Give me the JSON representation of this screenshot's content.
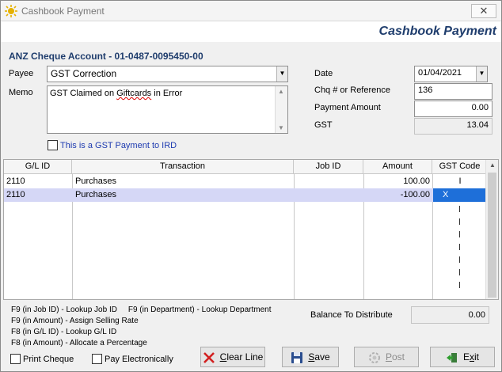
{
  "window": {
    "title": "Cashbook Payment",
    "banner_title": "Cashbook Payment",
    "close_glyph": "✕"
  },
  "form": {
    "account": "ANZ Cheque Account - 01-0487-0095450-00",
    "payee_label": "Payee",
    "payee_value": "GST Correction",
    "memo_label": "Memo",
    "memo_prefix": "GST Claimed on ",
    "memo_misspelled": "Giftcards",
    "memo_suffix": " in Error",
    "gst_ird_label": "This is a GST Payment to IRD",
    "date_label": "Date",
    "date_value": "01/04/2021",
    "chq_label": "Chq # or Reference",
    "chq_value": "136",
    "payment_label": "Payment Amount",
    "payment_value": "0.00",
    "gst_label": "GST",
    "gst_value": "13.04"
  },
  "grid": {
    "headers": [
      "G/L ID",
      "Transaction",
      "Job ID",
      "Amount",
      "GST Code"
    ],
    "rows": [
      {
        "gl_id": "2110",
        "transaction": "Purchases",
        "job_id": "",
        "amount": "100.00",
        "gst_code": "I"
      },
      {
        "gl_id": "2110",
        "transaction": "Purchases",
        "job_id": "",
        "amount": "-100.00",
        "gst_code": "X"
      }
    ]
  },
  "hints": [
    "F9 (in Job ID) - Lookup Job ID     F9 (in Department) - Lookup Department",
    "F9 (in Amount) - Assign Selling Rate",
    "F8 (in G/L ID) - Lookup G/L ID",
    "F8 (in Amount) - Allocate a Percentage"
  ],
  "balance": {
    "label": "Balance To Distribute",
    "value": "0.00"
  },
  "options": {
    "print_cheque": "Print Cheque",
    "pay_electronically": "Pay Electronically"
  },
  "buttons": {
    "clear_line_u": "C",
    "clear_line_rest": "lear Line",
    "save_u": "S",
    "save_rest": "ave",
    "post_u": "P",
    "post_rest": "ost",
    "exit_pre": "E",
    "exit_u": "x",
    "exit_rest": "it"
  },
  "colors": {
    "accent": "#1f3d6d",
    "selection": "#d5d7f6",
    "active_cell": "#1e6fd9"
  }
}
